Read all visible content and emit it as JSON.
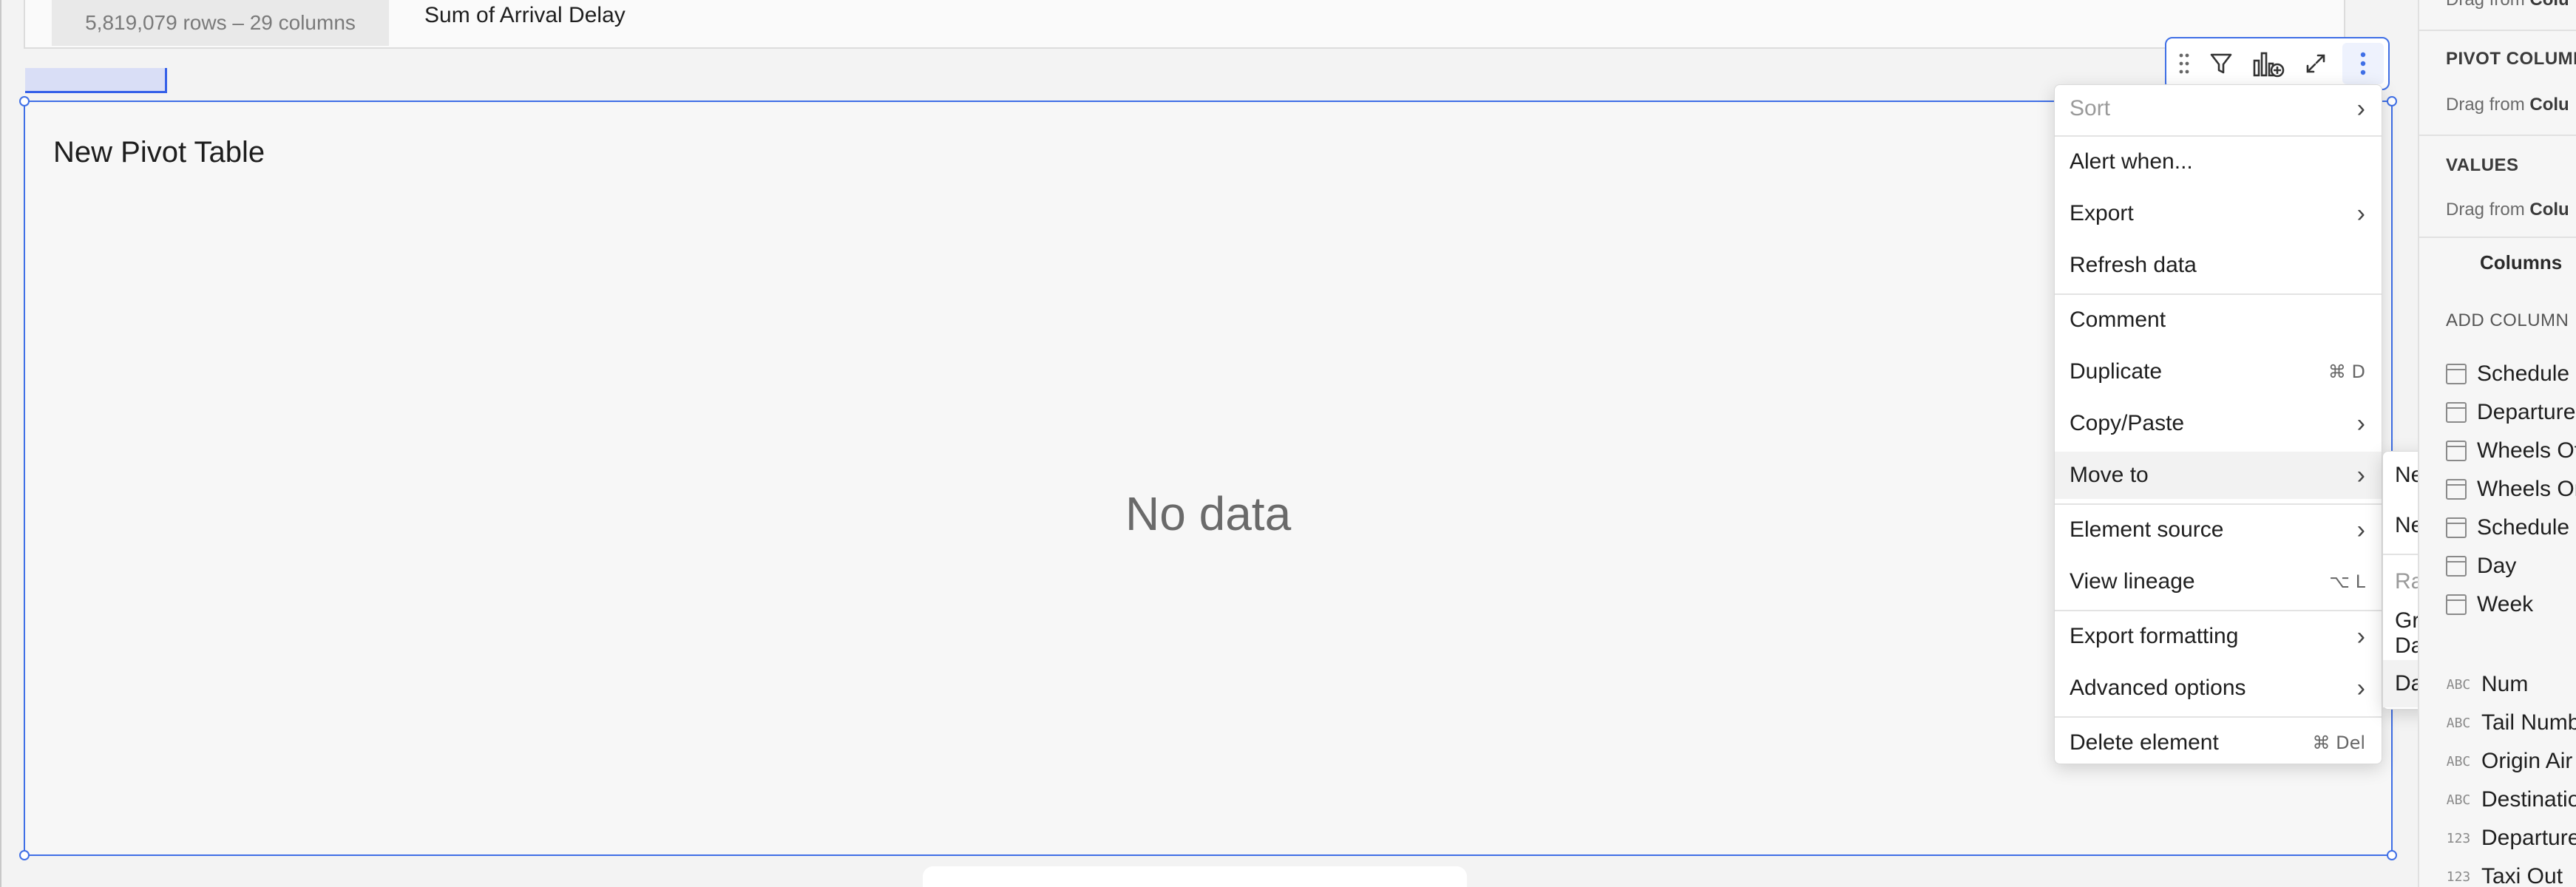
{
  "top_table": {
    "row_count": "5,819,079 rows – 29 columns",
    "column_header": "Sum of Arrival Delay"
  },
  "pivot": {
    "title": "New Pivot Table",
    "empty_text": "No data"
  },
  "toolbar": {
    "icons": [
      "drag-handle-icon",
      "filter-icon",
      "add-chart-icon",
      "expand-icon",
      "more-vertical-icon"
    ]
  },
  "menu": {
    "items": [
      {
        "label": "Sort",
        "shortcut": "",
        "submenu": true,
        "disabled": true
      },
      {
        "label": "Alert when...",
        "shortcut": "",
        "submenu": false
      },
      {
        "label": "Export",
        "shortcut": "",
        "submenu": true
      },
      {
        "label": "Refresh data",
        "shortcut": "",
        "submenu": false
      },
      {
        "label": "Comment",
        "shortcut": "",
        "submenu": false
      },
      {
        "label": "Duplicate",
        "shortcut": "⌘ D",
        "submenu": false
      },
      {
        "label": "Copy/Paste",
        "shortcut": "",
        "submenu": true
      },
      {
        "label": "Move to",
        "shortcut": "",
        "submenu": true
      },
      {
        "label": "Element source",
        "shortcut": "",
        "submenu": true
      },
      {
        "label": "View lineage",
        "shortcut": "⌥ L",
        "submenu": false
      },
      {
        "label": "Export formatting",
        "shortcut": "",
        "submenu": true
      },
      {
        "label": "Advanced options",
        "shortcut": "",
        "submenu": true
      },
      {
        "label": "Delete element",
        "shortcut": "⌘ Del",
        "submenu": false
      }
    ]
  },
  "submenu": {
    "items": [
      {
        "label": "New page"
      },
      {
        "label": "New modal"
      },
      {
        "label": "Raw Data",
        "disabled": true
      },
      {
        "label": "Grouped Data"
      },
      {
        "label": "Dashboard"
      }
    ]
  },
  "right_panel": {
    "drag_prefix": "Drag from",
    "drag_source": "Colu",
    "pivot_columns": "PIVOT COLUMNS",
    "values": "VALUES",
    "columns_tab": "Columns",
    "add_column": "ADD COLUMN",
    "items": [
      {
        "type": "date",
        "label": "Schedule"
      },
      {
        "type": "date",
        "label": "Departure"
      },
      {
        "type": "date",
        "label": "Wheels Of"
      },
      {
        "type": "date",
        "label": "Wheels On"
      },
      {
        "type": "date",
        "label": "Schedule"
      },
      {
        "type": "date",
        "label": "Day"
      },
      {
        "type": "date",
        "label": "Week"
      },
      {
        "type": "text",
        "label": "Num"
      },
      {
        "type": "text",
        "label": "Tail Numb"
      },
      {
        "type": "text",
        "label": "Origin Air"
      },
      {
        "type": "text",
        "label": "Destinatio"
      },
      {
        "type": "number",
        "label": "Departure"
      },
      {
        "type": "number",
        "label": "Taxi Out"
      }
    ],
    "type_badges": {
      "text": "ABC",
      "number": "123"
    }
  }
}
